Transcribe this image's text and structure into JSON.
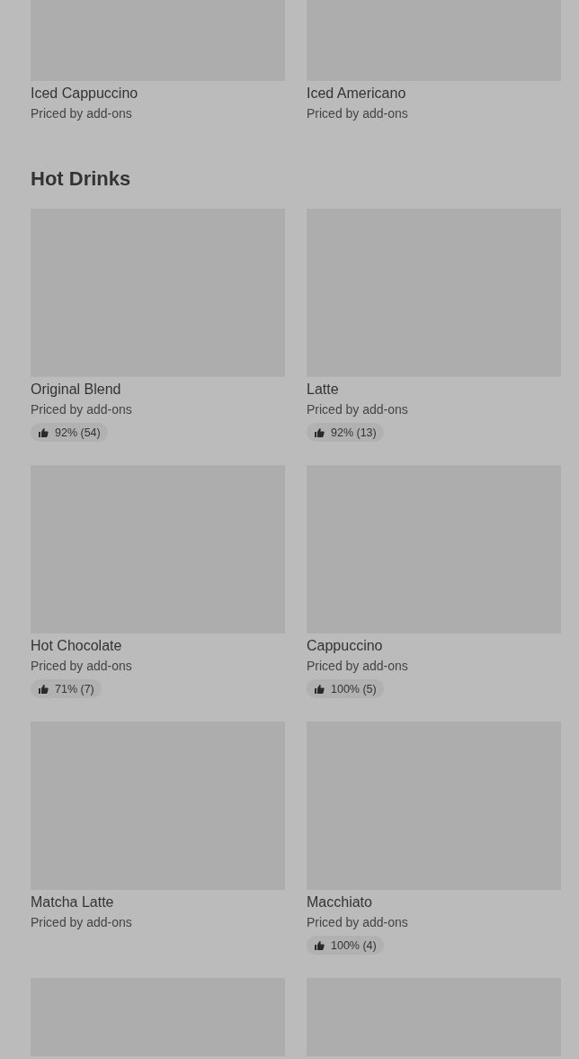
{
  "sections": [
    {
      "items": [
        {
          "name": "Iced Cappuccino",
          "price": "Priced by add-ons"
        },
        {
          "name": "Iced Americano",
          "price": "Priced by add-ons"
        }
      ]
    },
    {
      "title": "Hot Drinks",
      "items": [
        {
          "name": "Original Blend",
          "price": "Priced by add-ons",
          "rating": "92% (54)"
        },
        {
          "name": "Latte",
          "price": "Priced by add-ons",
          "rating": "92% (13)"
        },
        {
          "name": "Hot Chocolate",
          "price": "Priced by add-ons",
          "rating": "71% (7)"
        },
        {
          "name": "Cappuccino",
          "price": "Priced by add-ons",
          "rating": "100% (5)"
        },
        {
          "name": "Matcha Latte",
          "price": "Priced by add-ons"
        },
        {
          "name": "Macchiato",
          "price": "Priced by add-ons",
          "rating": "100% (4)"
        },
        {
          "kind": "picture"
        },
        {
          "kind": "picture"
        }
      ]
    }
  ]
}
